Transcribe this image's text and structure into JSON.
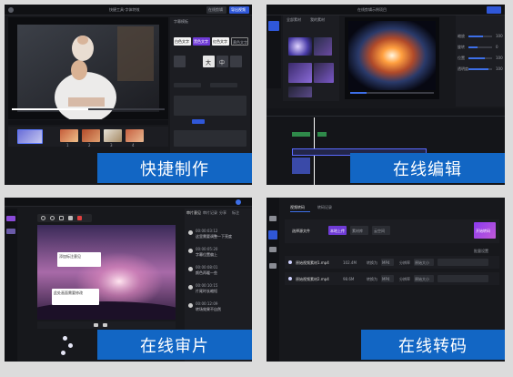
{
  "captions": {
    "quick_make": "快捷制作",
    "online_edit": "在线编辑",
    "online_review": "在线审片",
    "online_transcode": "在线转码"
  },
  "quick_make": {
    "window_title": "快捷工具-字体特效",
    "top_buttons": [
      "在线剪辑",
      "导出视频"
    ],
    "panel_tab": "字幕模板",
    "style_buttons": [
      "白色文字",
      "黑色文字",
      "红色文字",
      "黄色文字"
    ],
    "size_labels": [
      "大",
      "中"
    ],
    "thumb_labels": [
      "1",
      "2",
      "3",
      "4"
    ]
  },
  "online_edit": {
    "window_title": "在线剪辑示例项目",
    "left_tabs": [
      "视频",
      "图片",
      "音频",
      "文字",
      "特效",
      "转场"
    ],
    "media_tabs": [
      "全部素材",
      "我的素材",
      "图片素材"
    ],
    "right_buttons": [
      "导出视频"
    ],
    "prop_labels": [
      "缩放",
      "旋转",
      "位置",
      "透明度"
    ],
    "prop_values": [
      "100",
      "0",
      "100",
      "100"
    ],
    "timeline_marks": [
      "00:00",
      "00:05",
      "00:10",
      "00:15",
      "00:20",
      "00:25",
      "00:30",
      "00:35",
      "00:40",
      "00:45",
      "00:50",
      "00:55"
    ]
  },
  "online_review": {
    "tabs": [
      "审片意见",
      "审片记录",
      "分享",
      "标注"
    ],
    "comments": [
      {
        "time": "00:00:03:12",
        "text": "这里需要调整一下亮度"
      },
      {
        "time": "00:00:05:20",
        "text": "字幕位置偏上"
      },
      {
        "time": "00:00:08:01",
        "text": "颜色再暖一些"
      },
      {
        "time": "00:00:10:15",
        "text": "片尾时长缩短"
      },
      {
        "time": "00:00:12:09",
        "text": "转场效果不自然"
      }
    ],
    "popups": [
      "添加标注意见",
      "此处画面需要修改"
    ]
  },
  "online_transcode": {
    "tabs": [
      "视频转码",
      "转码记录"
    ],
    "section": "选择源文件",
    "buttons": [
      "本地上传",
      "素材库",
      "云空间"
    ],
    "start_button": "开始转码",
    "batch_link": "批量设置",
    "files": [
      {
        "name": "原始视频素材1.mp4",
        "size": "102.4M",
        "format_label": "转换为",
        "format": "MP4",
        "quality_label": "分辨率",
        "quality": "原始大小"
      },
      {
        "name": "原始视频素材2.mp4",
        "size": "98.6M",
        "format_label": "转换为",
        "format": "MP4",
        "quality_label": "分辨率",
        "quality": "原始大小"
      }
    ]
  }
}
